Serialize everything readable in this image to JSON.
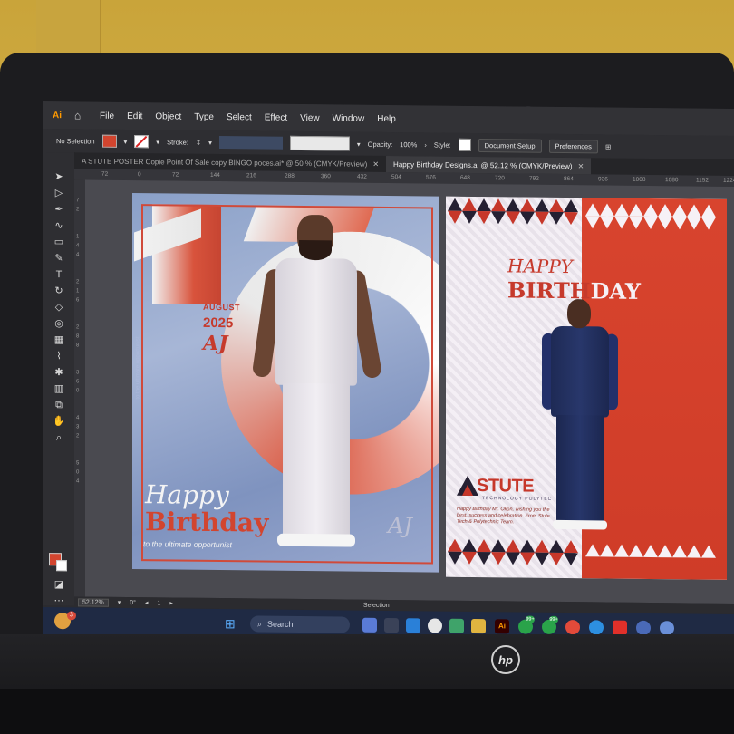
{
  "app": {
    "badge": "Ai"
  },
  "menu": [
    "File",
    "Edit",
    "Object",
    "Type",
    "Select",
    "Effect",
    "View",
    "Window",
    "Help"
  ],
  "control_bar": {
    "selection": "No Selection",
    "stroke_label": "Stroke:",
    "opacity_label": "Opacity:",
    "opacity_value": "100%",
    "style_label": "Style:",
    "document_setup": "Document Setup",
    "preferences": "Preferences"
  },
  "tabs": [
    {
      "label": "A STUTE POSTER Copie Point Of Sale copy BINGO poces.ai* @ 50 % (CMYK/Preview)"
    },
    {
      "label": "Happy Birthday Designs.ai @ 52.12 % (CMYK/Preview)"
    }
  ],
  "ruler": [
    "72",
    "0",
    "72",
    "144",
    "216",
    "288",
    "360",
    "432",
    "504",
    "576",
    "648",
    "720",
    "792",
    "864",
    "936",
    "1008",
    "1080",
    "1152",
    "1224"
  ],
  "vruler": [
    "7",
    "2",
    "1",
    "4",
    "4",
    "2",
    "1",
    "6",
    "2",
    "8",
    "8",
    "3",
    "6",
    "0",
    "4",
    "3",
    "2",
    "5",
    "0",
    "4"
  ],
  "poster1": {
    "month": "AUGUST",
    "year": "2025",
    "signature": "AJ",
    "happy": "Happy",
    "birthday": "Birthday",
    "tagline": "to the ultimate opportunist",
    "corner_sig": "AJ"
  },
  "poster2": {
    "happy": "HAPPY",
    "birth": "BIRTH",
    "day": "DAY",
    "logo": "STUTE",
    "logo_sub": "TECHNOLOGY POLYTEC",
    "message": "Happy Birthday Mr. Okon, wishing you the best, success and celebration. From Stute Tech & Polytechnic Team."
  },
  "status": {
    "zoom": "52.12%",
    "rotate": "0°",
    "page": "1",
    "tool": "Selection"
  },
  "taskbar": {
    "weather_badge": "3",
    "search": "Search",
    "ai_label": "Ai",
    "badge1": "99+",
    "badge2": "99+"
  },
  "colors": {
    "brand_red": "#d2452f",
    "navy": "#1e2a55",
    "ai_orange": "#ff9a00"
  }
}
